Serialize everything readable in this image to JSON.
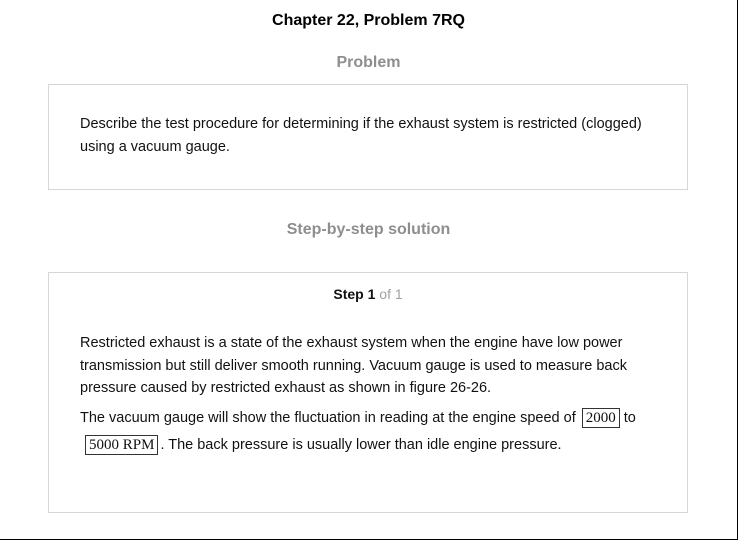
{
  "header": {
    "title": "Chapter 22, Problem 7RQ"
  },
  "problem": {
    "heading": "Problem",
    "text": "Describe the test procedure for determining if the exhaust system is restricted (clogged) using a vacuum gauge."
  },
  "solution": {
    "heading": "Step-by-step solution",
    "step": {
      "word": "Step",
      "number": "1",
      "of_text": "of 1"
    },
    "paragraph1": "Restricted exhaust is a state of the exhaust system when the engine have low power transmission but still deliver smooth running. Vacuum gauge is used to measure back pressure caused by restricted exhaust as shown in figure 26-26.",
    "paragraph2": {
      "text_before": "The vacuum gauge will show the fluctuation in reading at the engine speed of",
      "value_low": "2000",
      "text_middle": "to",
      "value_high": "5000 RPM",
      "text_after": ". The back pressure is usually lower than idle engine pressure."
    }
  }
}
